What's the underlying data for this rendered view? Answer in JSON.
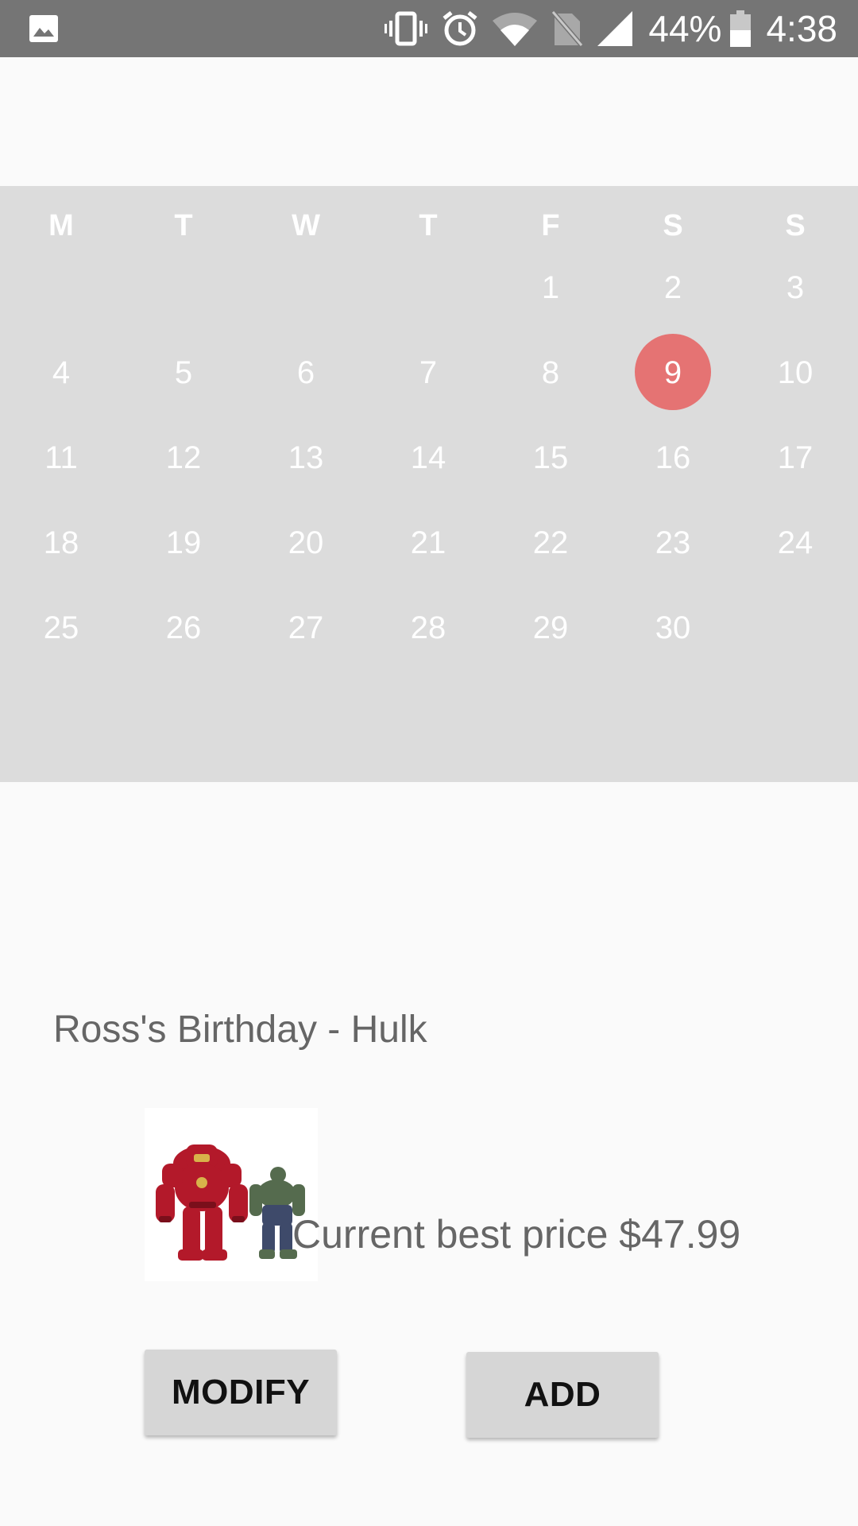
{
  "status_bar": {
    "battery_percent": "44%",
    "time": "4:38",
    "icons": [
      "gallery-icon",
      "vibrate-icon",
      "alarm-icon",
      "wifi-icon",
      "no-sim-icon",
      "signal-icon",
      "battery-icon"
    ]
  },
  "calendar": {
    "weekdays": [
      "M",
      "T",
      "W",
      "T",
      "F",
      "S",
      "S"
    ],
    "weeks": [
      [
        "",
        "",
        "",
        "",
        "1",
        "2",
        "3"
      ],
      [
        "4",
        "5",
        "6",
        "7",
        "8",
        "9",
        "10"
      ],
      [
        "11",
        "12",
        "13",
        "14",
        "15",
        "16",
        "17"
      ],
      [
        "18",
        "19",
        "20",
        "21",
        "22",
        "23",
        "24"
      ],
      [
        "25",
        "26",
        "27",
        "28",
        "29",
        "30",
        ""
      ]
    ],
    "selected_day": "9",
    "selected_color": "#e57373",
    "background_color": "#dcdcdc"
  },
  "event": {
    "title": "Ross's Birthday - Hulk",
    "price_text": "Current best price $47.99",
    "image_name": "hulkbuster-and-hulk-figures-image"
  },
  "actions": {
    "modify_label": "MODIFY",
    "add_label": "ADD"
  }
}
